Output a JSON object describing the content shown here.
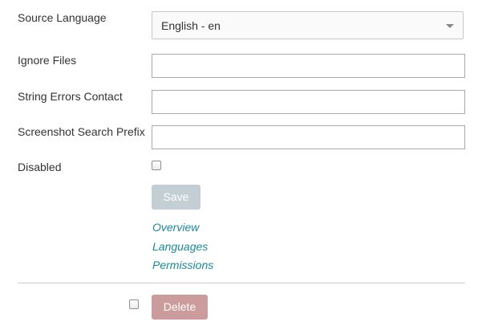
{
  "form": {
    "source_language": {
      "label": "Source Language",
      "selected": "English - en"
    },
    "ignore_files": {
      "label": "Ignore Files",
      "value": ""
    },
    "string_errors_contact": {
      "label": "String Errors Contact",
      "value": ""
    },
    "screenshot_search_prefix": {
      "label": "Screenshot Search Prefix",
      "value": ""
    },
    "disabled": {
      "label": "Disabled",
      "checked": false
    },
    "save_label": "Save"
  },
  "links": [
    {
      "label": "Overview"
    },
    {
      "label": "Languages"
    },
    {
      "label": "Permissions"
    }
  ],
  "delete_section": {
    "confirm_checked": false,
    "delete_label": "Delete"
  },
  "colors": {
    "link": "#1b8a99",
    "save_button_disabled": "#c4cfd5",
    "delete_button_disabled": "#cc9b9b",
    "text": "#333333"
  }
}
